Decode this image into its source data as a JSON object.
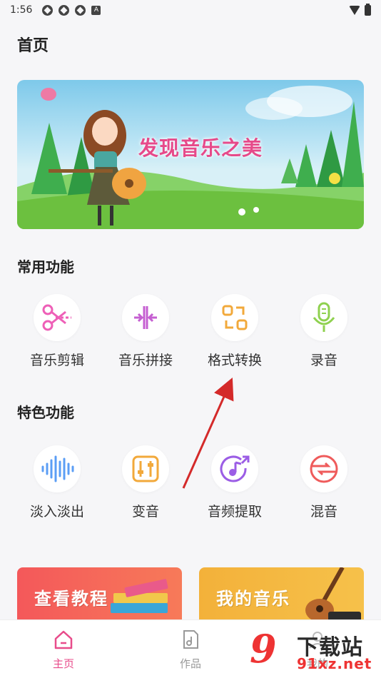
{
  "status_bar": {
    "time": "1:56"
  },
  "page": {
    "title": "首页"
  },
  "banner": {
    "text": "发现音乐之美"
  },
  "sections": {
    "common": {
      "title": "常用功能",
      "items": [
        {
          "label": "音乐剪辑",
          "icon": "scissors-icon"
        },
        {
          "label": "音乐拼接",
          "icon": "merge-icon"
        },
        {
          "label": "格式转换",
          "icon": "convert-icon"
        },
        {
          "label": "录音",
          "icon": "microphone-icon"
        }
      ]
    },
    "special": {
      "title": "特色功能",
      "items": [
        {
          "label": "淡入淡出",
          "icon": "waveform-icon"
        },
        {
          "label": "变音",
          "icon": "equalizer-icon"
        },
        {
          "label": "音频提取",
          "icon": "music-note-icon"
        },
        {
          "label": "混音",
          "icon": "mix-icon"
        }
      ]
    }
  },
  "cards": {
    "tutorial": "查看教程",
    "my_music": "我的音乐"
  },
  "bottom_nav": {
    "home": "主页",
    "works": "作品",
    "mine": "我的"
  },
  "watermark": {
    "text": "下载站",
    "url": "91xz.net"
  },
  "colors": {
    "accent": "#e84c8b",
    "pink_icon": "#ee5fb7",
    "purple_icon": "#9b5de5",
    "orange_icon": "#f2a93b",
    "green_icon": "#8fd14f",
    "blue_icon": "#5b9ef5",
    "red_icon": "#ef5b5b"
  }
}
